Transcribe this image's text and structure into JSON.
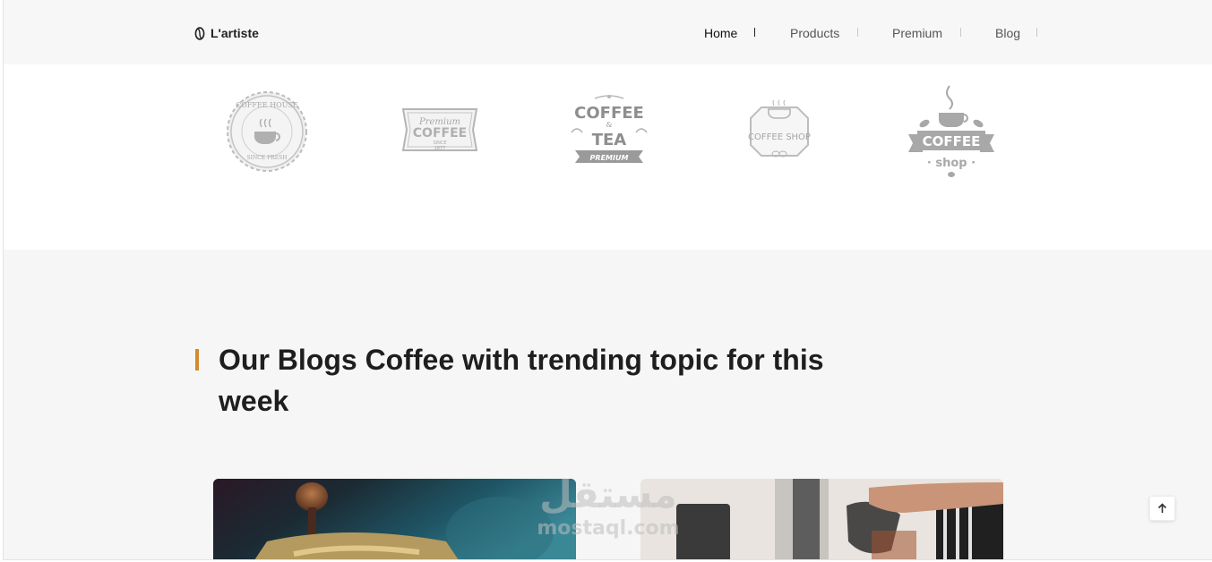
{
  "header": {
    "brand": "L'artiste",
    "nav": [
      {
        "label": "Home",
        "active": true
      },
      {
        "label": "Products",
        "active": false
      },
      {
        "label": "Premium",
        "active": false
      },
      {
        "label": "Blog",
        "active": false
      }
    ]
  },
  "brands": {
    "logos": [
      {
        "name": "coffee-house-badge",
        "lines": [
          "COFFEE HOUSE",
          "SINCE FRESH"
        ]
      },
      {
        "name": "premium-coffee-badge",
        "lines": [
          "Premium",
          "COFFEE",
          "SINCE",
          "1877"
        ]
      },
      {
        "name": "coffee-tea-badge",
        "lines": [
          "COFFEE",
          "&",
          "TEA",
          "PREMIUM"
        ]
      },
      {
        "name": "coffee-shop-badge",
        "lines": [
          "COFFEE SHOP"
        ]
      },
      {
        "name": "coffee-shop-ribbon-badge",
        "lines": [
          "COFFEE",
          "shop"
        ]
      }
    ],
    "color": "#b4b4b4"
  },
  "blog": {
    "title": "Our Blogs Coffee with trending topic for this week",
    "accent_color": "#d18a2c"
  },
  "watermark": {
    "arabic": "مستقل",
    "latin": "mostaql.com"
  },
  "scroll_top": {
    "icon": "arrow-up-icon"
  }
}
